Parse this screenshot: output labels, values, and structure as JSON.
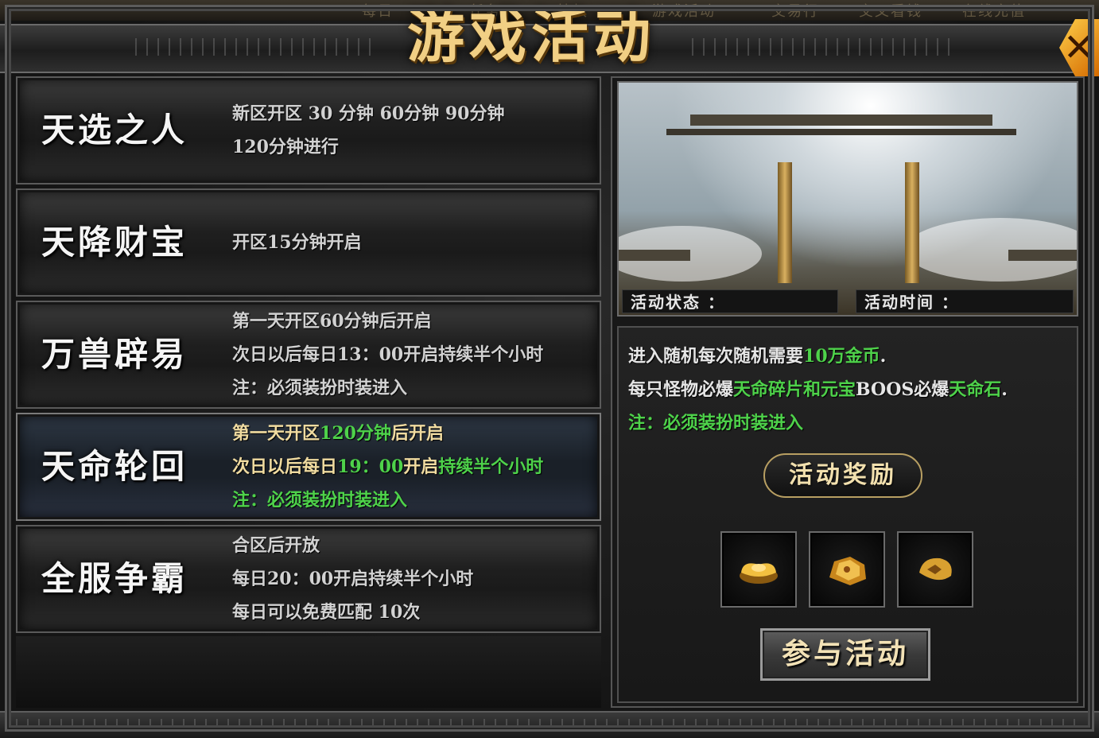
{
  "header": {
    "title": "游戏活动",
    "nav_tabs": [
      "每日",
      "任务",
      "特权",
      "游戏活动",
      "交易行",
      "交叉看钱",
      "在线充值"
    ],
    "close_label": "✕"
  },
  "activities": [
    {
      "name": "天选之人",
      "lines": [
        [
          {
            "t": "新区开区 30 分钟   60分钟  90分钟",
            "c": "w"
          }
        ],
        [
          {
            "t": "120分钟进行",
            "c": "w"
          }
        ]
      ]
    },
    {
      "name": "天降财宝",
      "lines": [
        [
          {
            "t": "开区15分钟开启",
            "c": "w"
          }
        ]
      ]
    },
    {
      "name": "万兽辟易",
      "lines": [
        [
          {
            "t": "第一天开区60分钟后开启",
            "c": "w"
          }
        ],
        [
          {
            "t": "次日以后每日13：00开启持续半个小时",
            "c": "w"
          }
        ],
        [
          {
            "t": "注：必须装扮时装进入",
            "c": "w"
          }
        ]
      ]
    },
    {
      "name": "天命轮回",
      "selected": true,
      "lines": [
        [
          {
            "t": "第一天开区",
            "c": "y"
          },
          {
            "t": "120分钟",
            "c": "g"
          },
          {
            "t": "后开启",
            "c": "y"
          }
        ],
        [
          {
            "t": "次日以后每日",
            "c": "y"
          },
          {
            "t": "19：00",
            "c": "g"
          },
          {
            "t": "开启",
            "c": "y"
          },
          {
            "t": "持续半个小时",
            "c": "g"
          }
        ],
        [
          {
            "t": "注：必须装扮时装进入",
            "c": "g"
          }
        ]
      ]
    },
    {
      "name": "全服争霸",
      "lines": [
        [
          {
            "t": "合区后开放",
            "c": "w"
          }
        ],
        [
          {
            "t": "每日20：00开启持续半个小时",
            "c": "w"
          }
        ],
        [
          {
            "t": "每日可以免费匹配 10次",
            "c": "w"
          }
        ]
      ]
    }
  ],
  "detail": {
    "status_label": "活动状态 ：",
    "time_label": "活动时间 ：",
    "info_lines": [
      [
        {
          "t": "进入随机每次随机需要",
          "c": "w"
        },
        {
          "t": "10万金币",
          "c": "g"
        },
        {
          "t": ".",
          "c": "w"
        }
      ],
      [
        {
          "t": "每只怪物必爆",
          "c": "w"
        },
        {
          "t": "天命碎片和元宝",
          "c": "g"
        },
        {
          "t": "BOOS必爆",
          "c": "w"
        },
        {
          "t": "天命石",
          "c": "g"
        },
        {
          "t": ".",
          "c": "w"
        }
      ],
      [
        {
          "t": "注：必须装扮时装进入",
          "c": "g"
        }
      ]
    ],
    "reward_title": "活动奖励",
    "rewards": [
      "gold-ingot-icon",
      "gold-ore-icon",
      "gold-nugget-icon"
    ],
    "join_label": "参与活动"
  },
  "colors": {
    "green": "#4ed24a",
    "gold_title": "#f1cf84",
    "text": "#d2d2d2"
  }
}
